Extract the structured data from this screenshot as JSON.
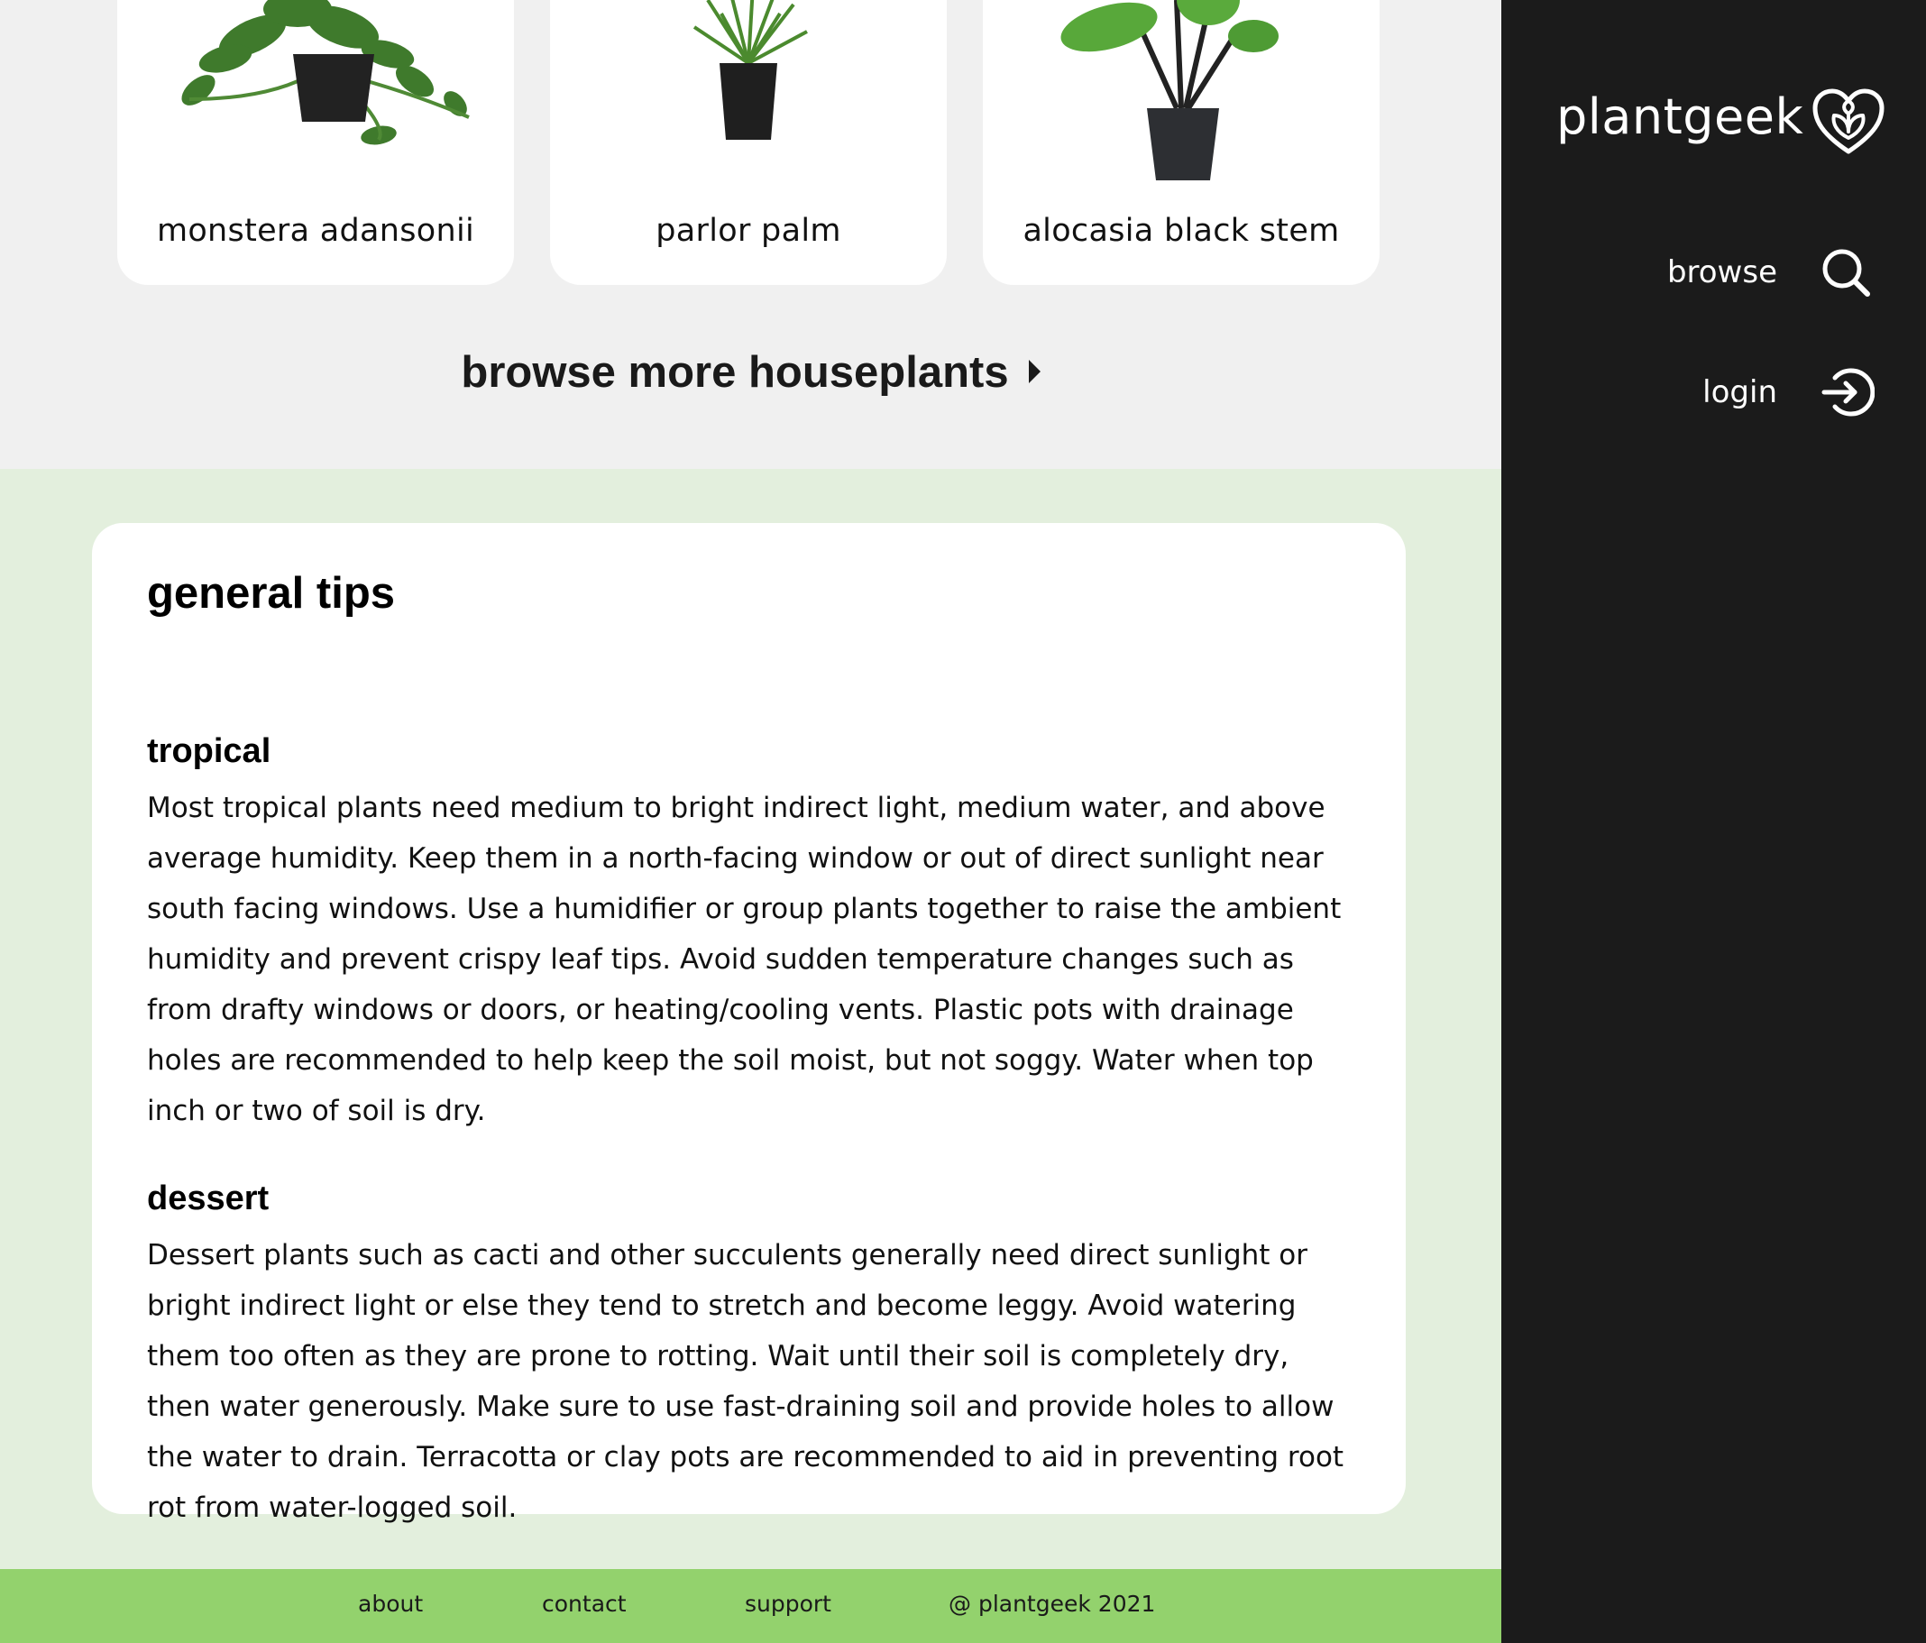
{
  "plant_cards": [
    {
      "name": "monstera adansonii"
    },
    {
      "name": "parlor palm"
    },
    {
      "name": "alocasia black stem"
    }
  ],
  "browse_more": {
    "label": "browse more houseplants",
    "icon": "caret-right-icon"
  },
  "tips": {
    "title": "general tips",
    "sections": [
      {
        "heading": "tropical",
        "body": "Most tropical plants need medium to bright indirect light, medium water, and above average humidity. Keep them in a north-facing window or out of direct sunlight near south facing windows. Use a humidifier or group plants together to raise the ambient humidity and prevent crispy leaf tips. Avoid sudden temperature changes such as from drafty windows or doors, or heating/cooling vents. Plastic pots with drainage holes are recommended to help keep the soil moist, but not soggy. Water when top inch or two of soil is dry."
      },
      {
        "heading": "dessert",
        "body": "Dessert plants such as cacti and other succulents generally need direct sunlight or bright indirect light or else they tend to stretch and become leggy. Avoid watering them too often as they are prone to rotting. Wait until their soil is completely dry, then water generously. Make sure to use fast-draining soil and provide holes to allow the water to drain. Terracotta or clay pots are recommended to aid in preventing root rot from water-logged soil."
      }
    ]
  },
  "footer": {
    "links": [
      "about",
      "contact",
      "support"
    ],
    "copyright": "@ plantgeek 2021"
  },
  "sidebar": {
    "logo_text": "plantgeek",
    "logo_icon": "heart-leaf-icon",
    "nav": [
      {
        "label": "browse",
        "icon": "search-icon"
      },
      {
        "label": "login",
        "icon": "login-icon"
      }
    ]
  },
  "colors": {
    "sidebar_bg": "#1b1b1b",
    "top_bg": "#f0f0f0",
    "tips_bg": "#e3efdd",
    "footer_bg": "#93d26d",
    "card_bg": "#ffffff"
  }
}
